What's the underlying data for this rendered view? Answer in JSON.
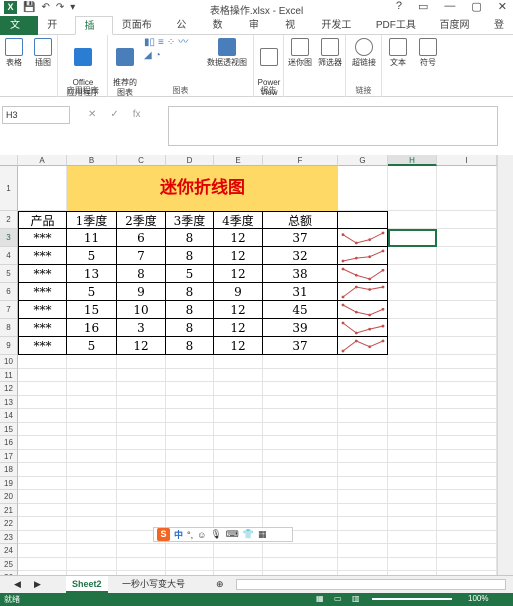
{
  "window": {
    "title": "表格操作.xlsx - Excel",
    "controls": [
      "?",
      "▭",
      "—",
      "▢",
      "✕"
    ]
  },
  "ribbon_tabs": [
    "文件",
    "开始",
    "插入",
    "页面布局",
    "公式",
    "数据",
    "审阅",
    "视图",
    "开发工具",
    "PDF工具集",
    "百度网盘",
    "登"
  ],
  "ribbon": {
    "groups": [
      {
        "label": "",
        "buttons": [
          "表格",
          "插图"
        ]
      },
      {
        "label": "应用程序",
        "buttons": [
          "Office\n应用程序"
        ]
      },
      {
        "label": "图表",
        "buttons": [
          "推荐的\n图表",
          "数据透视图"
        ]
      },
      {
        "label": "报告",
        "buttons": [
          "Power\nView"
        ]
      },
      {
        "label": "",
        "buttons": [
          "迷你图",
          "筛选器"
        ]
      },
      {
        "label": "链接",
        "buttons": [
          "超链接"
        ]
      },
      {
        "label": "",
        "buttons": [
          "文本",
          "符号"
        ]
      }
    ]
  },
  "formula_bar": {
    "name_box": "H3",
    "fx": "fx",
    "formula": ""
  },
  "columns": [
    "A",
    "B",
    "C",
    "D",
    "E",
    "F",
    "G",
    "H",
    "I"
  ],
  "rows": [
    "1",
    "2",
    "3",
    "4",
    "5",
    "6",
    "7",
    "8",
    "9",
    "10",
    "11",
    "12",
    "13",
    "14",
    "15",
    "16",
    "17",
    "18",
    "19",
    "20",
    "21",
    "22",
    "23",
    "24",
    "25",
    "26"
  ],
  "sheet": {
    "title": "迷你折线图",
    "headers": [
      "产品",
      "1季度",
      "2季度",
      "3季度",
      "4季度",
      "总额"
    ],
    "data": [
      [
        "***",
        "11",
        "6",
        "8",
        "12",
        "37"
      ],
      [
        "***",
        "5",
        "7",
        "8",
        "12",
        "32"
      ],
      [
        "***",
        "13",
        "8",
        "5",
        "12",
        "38"
      ],
      [
        "***",
        "5",
        "9",
        "8",
        "9",
        "31"
      ],
      [
        "***",
        "15",
        "10",
        "8",
        "12",
        "45"
      ],
      [
        "***",
        "16",
        "3",
        "8",
        "12",
        "39"
      ],
      [
        "***",
        "5",
        "12",
        "8",
        "12",
        "37"
      ]
    ],
    "sparkline_color": "#c0504d"
  },
  "sheet_tabs": [
    "Sheet2",
    "一秒小写变大号"
  ],
  "ime_toolbar": {
    "logo": "S",
    "mode": "中"
  },
  "status": {
    "ready": "就绪",
    "zoom": "100%"
  }
}
